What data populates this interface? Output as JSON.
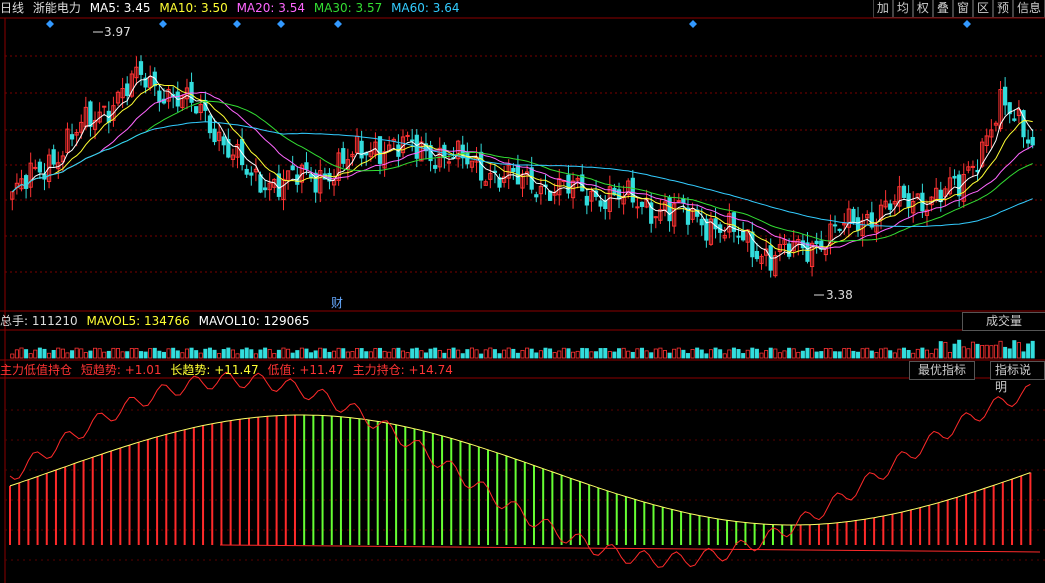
{
  "header": {
    "period": "日线",
    "stock": "浙能电力",
    "ma": [
      {
        "label": "MA5:",
        "value": "3.45",
        "color": "#ffffff"
      },
      {
        "label": "MA10:",
        "value": "3.50",
        "color": "#ffff33"
      },
      {
        "label": "MA20:",
        "value": "3.54",
        "color": "#ff66ff"
      },
      {
        "label": "MA30:",
        "value": "3.57",
        "color": "#33dd33"
      },
      {
        "label": "MA60:",
        "value": "3.64",
        "color": "#33ccff"
      }
    ],
    "buttons": [
      "加",
      "均",
      "权",
      "叠",
      "窗",
      "区",
      "预",
      "信息"
    ]
  },
  "volume": {
    "label": "总手:",
    "value": "111210",
    "mavol5_label": "MAVOL5:",
    "mavol5": "134766",
    "mavol10_label": "MAVOL10:",
    "mavol10": "129065",
    "button": "成交量"
  },
  "indicator": {
    "name": "主力低值持仓",
    "short_label": "短趋势:",
    "short": "+1.01",
    "long_label": "长趋势:",
    "long": "+11.47",
    "low_label": "低值:",
    "low": "+11.47",
    "hold_label": "主力持仓:",
    "hold": "+14.74",
    "buttons": [
      "最优指标",
      "指标说明"
    ]
  },
  "chart_data": {
    "type": "candlestick",
    "annotations": {
      "high": "3.97",
      "low": "3.38",
      "marker": "财"
    },
    "price_range": [
      3.3,
      4.05
    ],
    "colors": {
      "up": "#ff3333",
      "down": "#33dddd"
    },
    "key_prices": {
      "start": 3.55,
      "peak": 3.97,
      "mid_high": 3.82,
      "trough": 3.38,
      "end": 3.9
    }
  }
}
